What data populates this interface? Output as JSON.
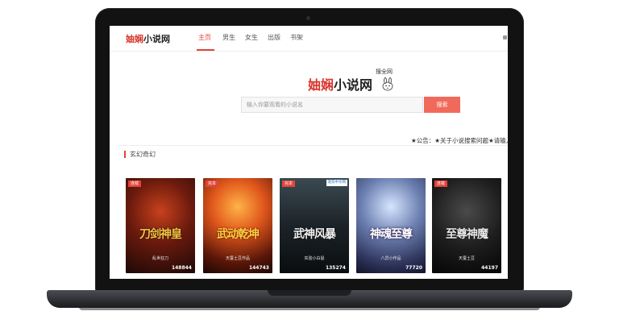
{
  "site": {
    "brand_red": "妯娴",
    "brand_black": "小说网",
    "tagline": "搜全网"
  },
  "nav": {
    "items": [
      {
        "label": "主页",
        "active": true
      },
      {
        "label": "男生",
        "active": false
      },
      {
        "label": "女生",
        "active": false
      },
      {
        "label": "出版",
        "active": false
      },
      {
        "label": "书架",
        "active": false
      }
    ]
  },
  "search": {
    "placeholder": "输入你要观看的小说名",
    "button_label": "搜索"
  },
  "notice": "★公告：★关于小说搜索问题★请输入",
  "section": {
    "title": "玄幻奇幻"
  },
  "books": [
    {
      "title": "刀剑神皇",
      "author": "乱世狂刀",
      "count": "148844",
      "tag": "连载",
      "publisher": "",
      "palette": "red"
    },
    {
      "title": "武动乾坤",
      "author": "天蚕土豆作品",
      "count": "144743",
      "tag": "完本",
      "publisher": "",
      "palette": "fire"
    },
    {
      "title": "武神风暴",
      "author": "实验小白鼠",
      "count": "135274",
      "tag": "完本",
      "publisher": "逐浪中文网",
      "palette": "storm"
    },
    {
      "title": "神魂至尊",
      "author": "八异小作品",
      "count": "77720",
      "tag": "",
      "publisher": "",
      "palette": "sky"
    },
    {
      "title": "至尊神魔",
      "author": "天蚕土豆",
      "count": "44197",
      "tag": "连载",
      "publisher": "",
      "palette": "dark"
    }
  ],
  "colors": {
    "accent": "#e2433b",
    "search_button": "#f06a5c",
    "laptop_bezel": "#121212"
  }
}
